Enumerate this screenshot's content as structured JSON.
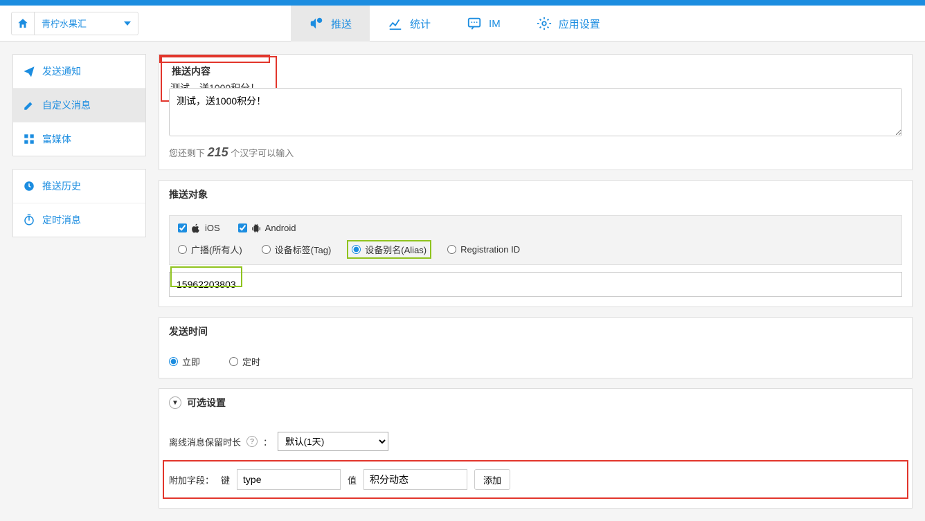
{
  "app": {
    "name": "青柠水果汇"
  },
  "nav": {
    "push": "推送",
    "stats": "统计",
    "im": "IM",
    "settings": "应用设置"
  },
  "sidebar": {
    "send_notify": "发送通知",
    "custom_msg": "自定义消息",
    "rich_media": "富媒体",
    "history": "推送历史",
    "scheduled": "定时消息"
  },
  "content": {
    "title": "推送内容",
    "text": "测试，送1000积分！",
    "counter_prefix": "您还剩下 ",
    "counter_value": "215",
    "counter_suffix": " 个汉字可以输入"
  },
  "target": {
    "title": "推送对象",
    "ios": "iOS",
    "android": "Android",
    "broadcast": "广播(所有人)",
    "tag": "设备标签(Tag)",
    "alias": "设备别名(Alias)",
    "regid": "Registration ID",
    "alias_value": "15962203803"
  },
  "time": {
    "title": "发送时间",
    "now": "立即",
    "scheduled": "定时"
  },
  "optional": {
    "title": "可选设置",
    "toggle": "▼",
    "ttl_label": "离线消息保留时长",
    "colon": "：",
    "ttl_value": "默认(1天)",
    "extra_label": "附加字段：",
    "key_label": "键",
    "key_value": "type",
    "val_label": "值",
    "val_value": "积分动态",
    "add": "添加"
  }
}
